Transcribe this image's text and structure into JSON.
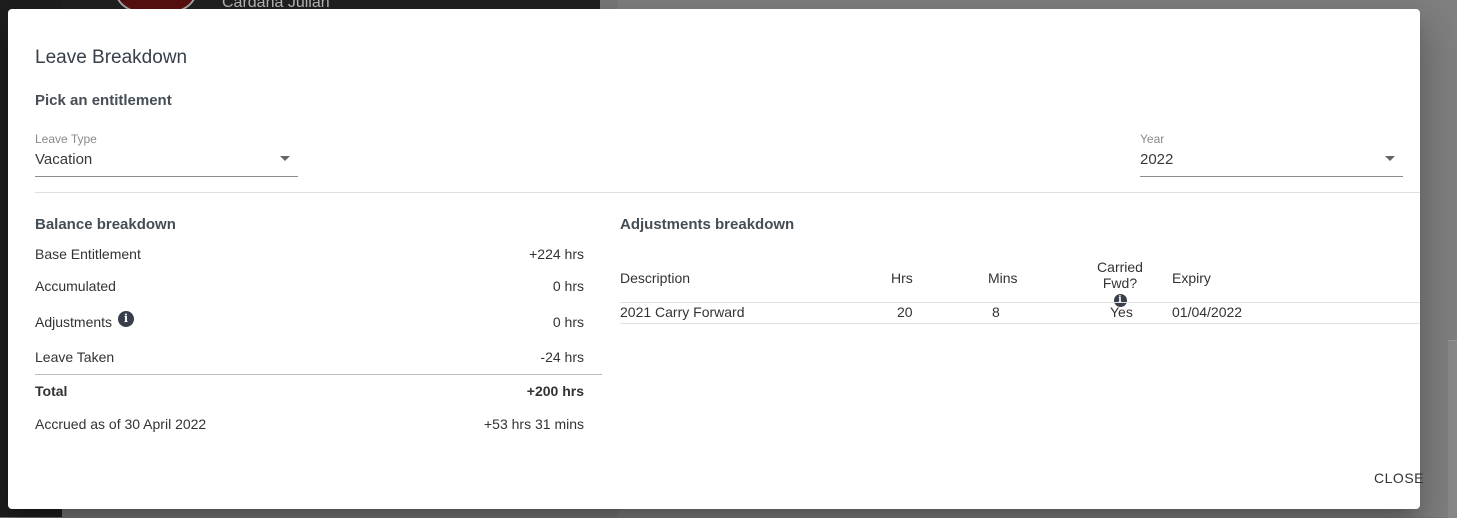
{
  "background": {
    "user_name": "Cardana Julian"
  },
  "dialog": {
    "title": "Leave Breakdown",
    "subtitle": "Pick an entitlement",
    "leave_type": {
      "label": "Leave Type",
      "value": "Vacation"
    },
    "year": {
      "label": "Year",
      "value": "2022"
    },
    "balance": {
      "heading": "Balance breakdown",
      "rows": [
        {
          "label": "Base Entitlement",
          "value": "+224 hrs"
        },
        {
          "label": "Accumulated",
          "value": "0 hrs"
        },
        {
          "label": "Adjustments",
          "value": "0 hrs"
        },
        {
          "label": "Leave Taken",
          "value": "-24 hrs"
        }
      ],
      "total": {
        "label": "Total",
        "value": "+200 hrs"
      },
      "accrued": {
        "label": "Accrued as of 30 April 2022",
        "value": "+53 hrs 31 mins"
      }
    },
    "adjustments": {
      "heading": "Adjustments breakdown",
      "columns": {
        "description": "Description",
        "hrs": "Hrs",
        "mins": "Mins",
        "carried": "Carried Fwd?",
        "expiry": "Expiry"
      },
      "rows": [
        {
          "description": "2021 Carry Forward",
          "hrs": "20",
          "mins": "8",
          "carried": "Yes",
          "expiry": "01/04/2022"
        }
      ]
    },
    "close_label": "CLOSE"
  },
  "icons": {
    "info": "info-icon",
    "dropdown": "caret-down-icon"
  },
  "colors": {
    "title": "#37404a",
    "overlay": "#7a7a7a",
    "dialog_bg": "#ffffff"
  }
}
